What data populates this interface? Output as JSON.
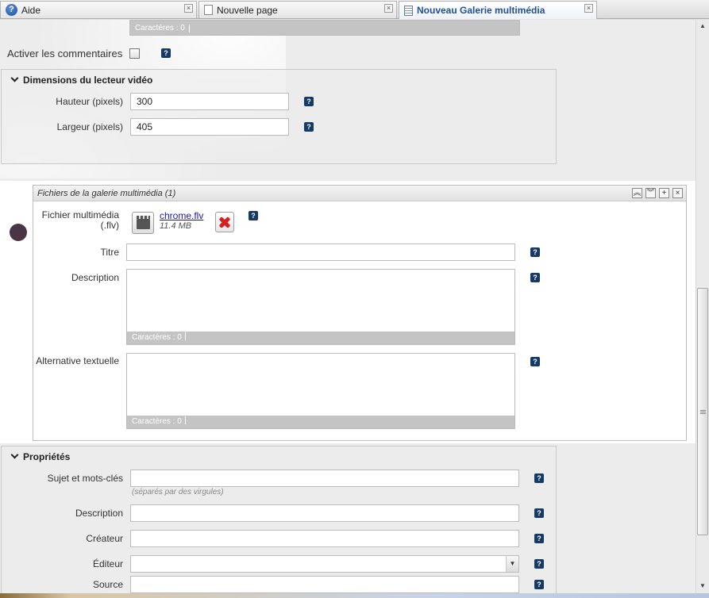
{
  "tabs": [
    {
      "label": "Aide",
      "icon": "help-icon",
      "close": "×"
    },
    {
      "label": "Nouvelle page",
      "icon": "page-icon",
      "close": "×"
    },
    {
      "label": "Nouveau Galerie multimédia",
      "icon": "document-icon",
      "close": "×"
    }
  ],
  "top_counter": {
    "label": "Caractères : 0"
  },
  "comments": {
    "label": "Activer les commentaires",
    "checked": false
  },
  "video_dimensions": {
    "title": "Dimensions du lecteur vidéo",
    "height_label": "Hauteur (pixels)",
    "height_value": "300",
    "width_label": "Largeur (pixels)",
    "width_value": "405"
  },
  "gallery": {
    "title": "Fichiers de la galerie multimédia (1)",
    "buttons": [
      "︽",
      "︾",
      "+",
      "×"
    ],
    "file_label": "Fichier multimédia (.flv)",
    "file_name": "chrome.flv",
    "file_size": "11.4 MB",
    "title_label": "Titre",
    "title_value": "",
    "description_label": "Description",
    "description_counter": "Caractères : 0",
    "alt_label": "Alternative textuelle",
    "alt_counter": "Caractères : 0"
  },
  "properties": {
    "title": "Propriétés",
    "subject_label": "Sujet et mots-clés",
    "subject_hint": "(séparés par des virgules)",
    "description_label": "Description",
    "creator_label": "Créateur",
    "editor_label": "Éditeur",
    "editor_selected": "",
    "source_label": "Source"
  },
  "help_glyph": "?",
  "colors": {
    "accent": "#1f4f9b",
    "help_button": "#163a66",
    "delete": "#d42020",
    "bullet": "#4a3547"
  }
}
